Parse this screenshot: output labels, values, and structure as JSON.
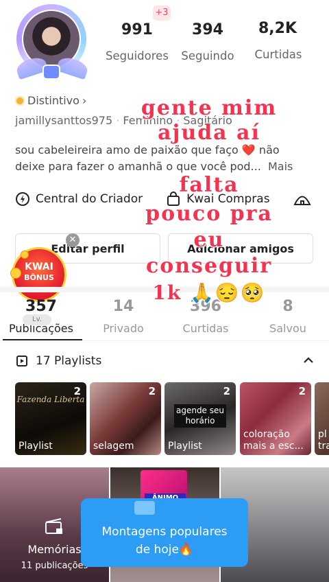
{
  "profile": {
    "plus_badge": "+3",
    "stats": [
      {
        "value": "991",
        "label": "Seguidores"
      },
      {
        "value": "394",
        "label": "Seguindo"
      },
      {
        "value": "8,2K",
        "label": "Curtidas"
      }
    ],
    "badge_label": "Distintivo",
    "badge_chevron": "›",
    "username": "jamillysanttos975",
    "gender": "Feminino",
    "sign": "Sagitário",
    "bio_line1": "sou cabeleireira amo de paixão que faço ",
    "bio_heart": "❤️",
    "bio_line1_end": " não",
    "bio_line2": "deixe para fazer o amanhã o que você pod...",
    "bio_more": "Mais"
  },
  "menu": {
    "creator_center": "Central do Criador",
    "kwai_shop": "Kwai Compras"
  },
  "buttons": {
    "edit_profile": "Editar perfil",
    "add_friends": "Adicionar amigos"
  },
  "kwai_bonus": {
    "line1": "KWAI",
    "line2": "BÔNUS"
  },
  "tabs": [
    {
      "count": "357",
      "label": "Publicações"
    },
    {
      "count": "14",
      "label": "Privado"
    },
    {
      "count": "396",
      "label": "Curtidas"
    },
    {
      "count": "8",
      "label": "Salvou"
    }
  ],
  "level_badge": "Lv.",
  "playlists": {
    "header": "17 Playlists",
    "items": [
      {
        "count": "2",
        "caption": "Playlist",
        "title": "Fazenda Liberta"
      },
      {
        "count": "2",
        "caption": "selagem"
      },
      {
        "count": "2",
        "caption": "Playlist",
        "title": "agende seu horário"
      },
      {
        "count": "2",
        "caption": "coloração mais a esc..."
      },
      {
        "count": "",
        "caption": "pl tra"
      }
    ]
  },
  "memories": {
    "title": "Memórias",
    "count": "11 publicações"
  },
  "animo_tag": "ÂNIMO",
  "popular": {
    "line1": "Montagens populares",
    "line2": "de hoje🔥"
  },
  "overlay": {
    "line1": "gente mim",
    "line2": "ajuda aí",
    "line3": "falta",
    "line4": "pouco pra",
    "line5": "eu",
    "line6": "conseguir",
    "line7": "1k 🙏😔🥺"
  },
  "colors": {
    "overlay": "#f33350",
    "accent_blue": "#2d9cf5",
    "plus_badge": "#f0445a"
  }
}
